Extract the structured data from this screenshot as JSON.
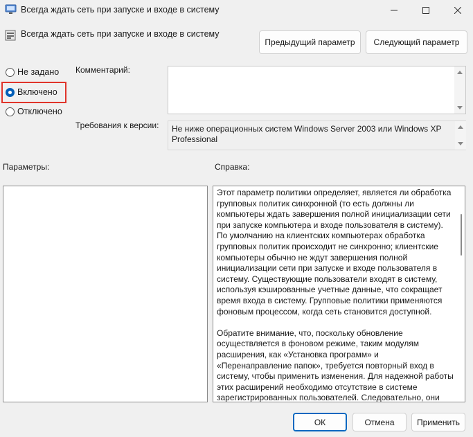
{
  "window": {
    "title": "Всегда ждать сеть при запуске и входе в систему",
    "icon": "policy-settings-icon"
  },
  "header": {
    "title": "Всегда ждать сеть при запуске и входе в систему",
    "prev_label": "Предыдущий параметр",
    "next_label": "Следующий параметр"
  },
  "state": {
    "options": [
      "Не задано",
      "Включено",
      "Отключено"
    ],
    "selected": "Включено"
  },
  "comment": {
    "label": "Комментарий:",
    "value": ""
  },
  "requirements": {
    "label": "Требования к версии:",
    "value": "Не ниже операционных систем Windows Server 2003 или Windows XP Professional"
  },
  "params": {
    "label": "Параметры:"
  },
  "help": {
    "label": "Справка:",
    "paragraphs": [
      "Этот параметр политики определяет, является ли обработка групповых политик синхронной (то есть должны ли компьютеры ждать завершения полной инициализации сети при запуске компьютера и входе пользователя в систему). По умолчанию на клиентских компьютерах обработка групповых политик происходит не синхронно; клиентские компьютеры обычно не ждут завершения полной инициализации сети при запуске и входе пользователя в систему. Существующие пользователи входят в систему, используя кэшированные учетные данные, что сокращает время входа в систему. Групповые политики применяются фоновым процессом, когда сеть становится доступной.",
      "Обратите внимание, что, поскольку обновление осуществляется в фоновом режиме, таким модулям расширения, как «Установка программ» и «Перенаправление папок», требуется повторный вход в систему, чтобы применить изменения. Для надежной работы этих расширений необходимо отсутствие в системе зарегистрированных пользователей. Следовательно, они должны быть отработаны как основные до начала активного"
    ]
  },
  "footer": {
    "ok_label": "ОК",
    "cancel_label": "Отмена",
    "apply_label": "Применить"
  },
  "colors": {
    "accent": "#005fb8",
    "highlight": "#e0342a"
  }
}
